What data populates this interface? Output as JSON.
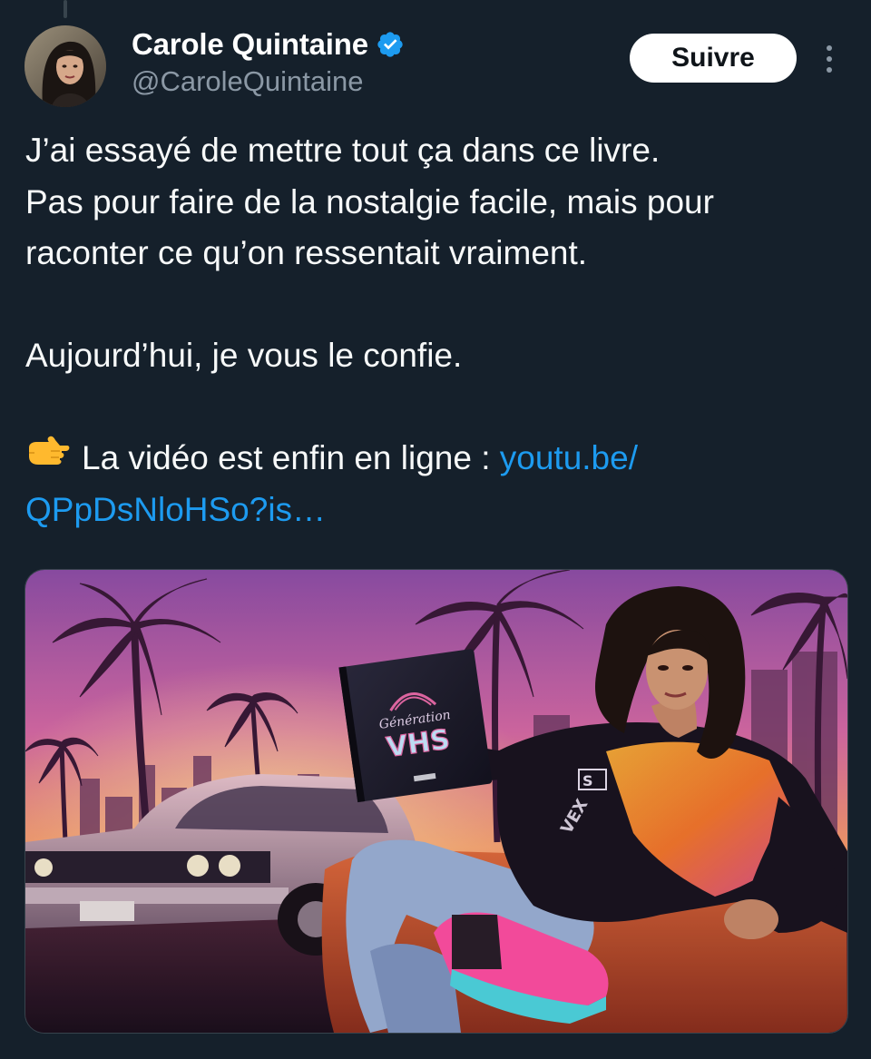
{
  "author": {
    "display_name": "Carole Quintaine",
    "handle": "@CaroleQuintaine",
    "verified": true
  },
  "actions": {
    "follow_label": "Suivre",
    "more_icon": "more-vertical-icon"
  },
  "tweet": {
    "lines": [
      "J’ai essayé de mettre tout ça dans ce livre.",
      "Pas pour faire de la nostalgie facile, mais pour",
      "raconter ce qu’on ressentait vraiment.",
      "",
      "Aujourd’hui, je vous le confie.",
      ""
    ],
    "cta_emoji": "👉",
    "cta_text": "La vidéo est enfin en ligne : ",
    "link_part1": "youtu.be/",
    "link_part2": "QPpDsNloHSo?is…"
  },
  "media": {
    "book_text_script": "Génération",
    "book_text_title": "VHS",
    "shirt_text": "VEX"
  },
  "colors": {
    "background": "#15202b",
    "link": "#1d9bf0",
    "secondary_text": "#8b98a5",
    "verified": "#1d9bf0"
  }
}
